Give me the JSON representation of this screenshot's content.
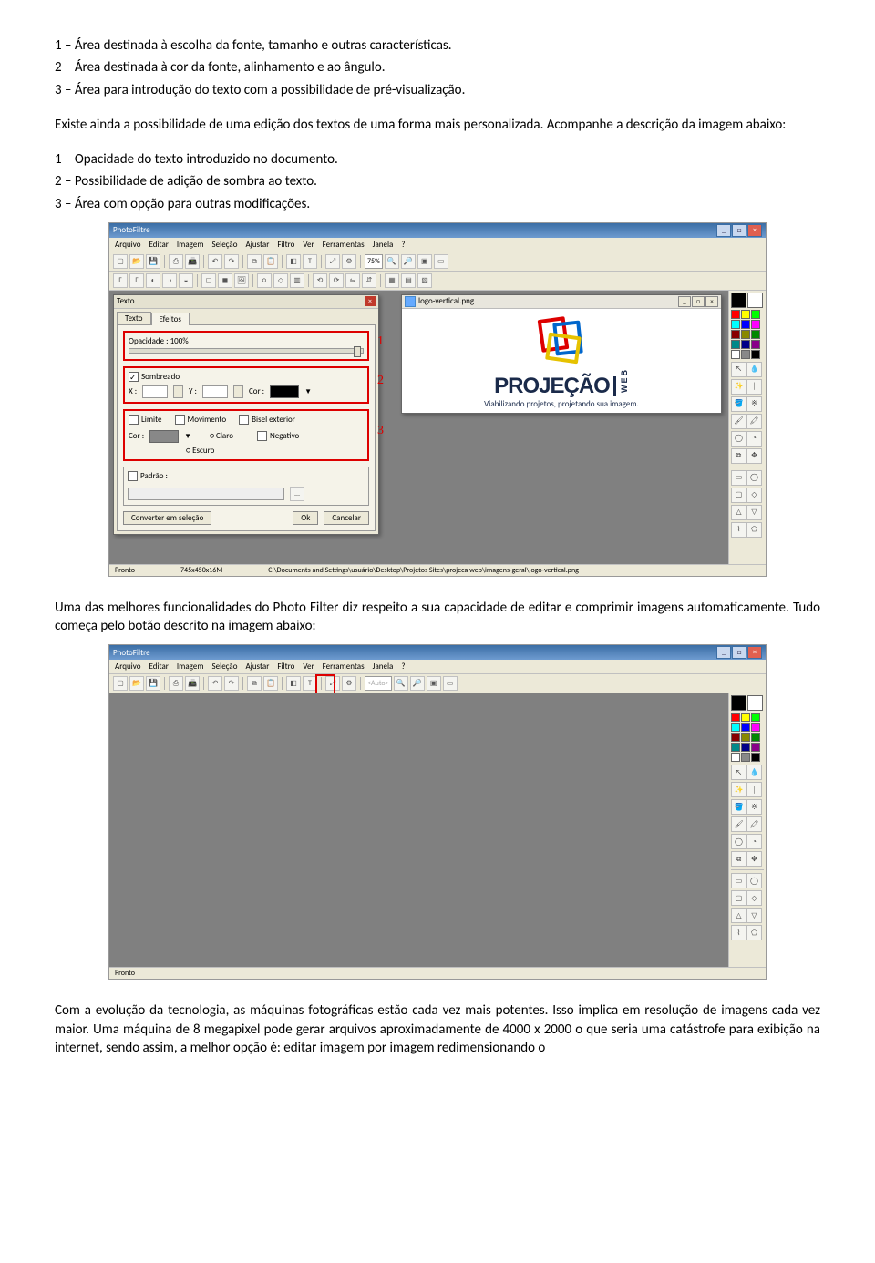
{
  "intro": {
    "l1": "1 – Área destinada à escolha da fonte, tamanho e outras características.",
    "l2": "2 – Área destinada à cor da fonte, alinhamento e ao ângulo.",
    "l3": "3 – Área para introdução do texto com a possibilidade de pré-visualização.",
    "p2": "Existe ainda a possibilidade de uma edição dos textos de uma forma mais personalizada. Acompanhe a descrição da imagem abaixo:",
    "l4": "1 – Opacidade do texto introduzido no documento.",
    "l5": "2 – Possibilidade de adição de sombra ao texto.",
    "l6": "3 – Área com opção para outras modificações."
  },
  "app": {
    "title": "PhotoFiltre",
    "menus": [
      "Arquivo",
      "Editar",
      "Imagem",
      "Seleção",
      "Ajustar",
      "Filtro",
      "Ver",
      "Ferramentas",
      "Janela",
      "?"
    ],
    "zoom": "75%"
  },
  "textoDlg": {
    "title": "Texto",
    "tabTexto": "Texto",
    "tabEfeitos": "Efeitos",
    "opLabel": "Opacidade : 100%",
    "sombreado": "Sombreado",
    "x": "X :",
    "y": "Y :",
    "cor": "Cor :",
    "limite": "Limite",
    "movimento": "Movimento",
    "bisel": "Bisel exterior",
    "negativo": "Negativo",
    "corLabel": "Cor :",
    "claroOpt": "Claro",
    "escuroOpt": "Escuro",
    "padrao": "Padrão :",
    "btnConvert": "Converter em seleção",
    "btnOk": "Ok",
    "btnCancel": "Cancelar",
    "c1": "1",
    "c2": "2",
    "c3": "3"
  },
  "imgWin": {
    "title": "logo-vertical.png",
    "logo": "PROJEÇÃO",
    "web": "WEB",
    "tag": "Viabilizando projetos, projetando sua imagem."
  },
  "status1": {
    "a": "Pronto",
    "b": "745x450x16M",
    "c": "C:\\Documents and Settings\\usuário\\Desktop\\Projetos Sites\\projeca web\\imagens-geral\\logo-vertical.png"
  },
  "mid": {
    "p1": "Uma das melhores funcionalidades do Photo Filter diz respeito a sua capacidade de editar e comprimir imagens automaticamente. Tudo começa pelo botão descrito na imagem abaixo:"
  },
  "status2": {
    "a": "Pronto"
  },
  "end": {
    "p1": "Com a evolução da tecnologia, as máquinas fotográficas estão cada vez mais potentes. Isso implica em resolução de imagens cada vez maior. Uma máquina de 8 megapixel pode gerar arquivos aproximadamente de 4000 x 2000 o que seria uma catástrofe para exibição na internet, sendo assim, a melhor opção é: editar imagem por imagem redimensionando o"
  }
}
